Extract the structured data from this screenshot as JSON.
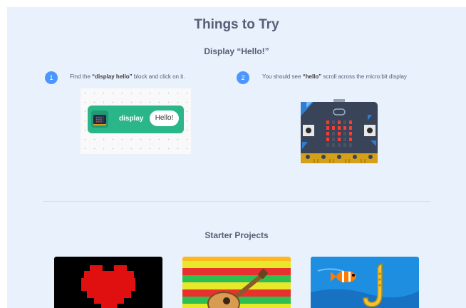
{
  "header": {
    "title": "Things to Try"
  },
  "activity": {
    "title": "Display “Hello!”",
    "steps": [
      {
        "number": "1",
        "text_before": "Find the ",
        "text_bold": "“display hello”",
        "text_after": " block and click on it."
      },
      {
        "number": "2",
        "text_before": "You should see ",
        "text_bold": "“hello”",
        "text_after": " scroll across the micro:bit display"
      }
    ],
    "block": {
      "label": "display",
      "value": "Hello!",
      "color": "#2bb68a"
    }
  },
  "starter": {
    "title": "Starter Projects",
    "projects": [
      {
        "icon": "heart-icon"
      },
      {
        "icon": "guitar-icon"
      },
      {
        "icon": "fish-saxophone-icon"
      }
    ]
  },
  "colors": {
    "accent": "#4c97ff",
    "text": "#575e75",
    "background": "#e9f1fc"
  }
}
